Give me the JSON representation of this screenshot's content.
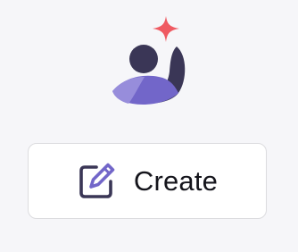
{
  "app": {
    "logo_icon": "person-star-logo-icon",
    "colors": {
      "star": "#ef5a62",
      "head": "#3a3656",
      "body_dark": "#3a3656",
      "body_light": "#7266c9",
      "body_lighter": "#978ddb",
      "icon_stroke": "#3a3656",
      "pencil_accent": "#7266c9"
    }
  },
  "create_button": {
    "label": "Create",
    "icon": "edit-icon"
  }
}
